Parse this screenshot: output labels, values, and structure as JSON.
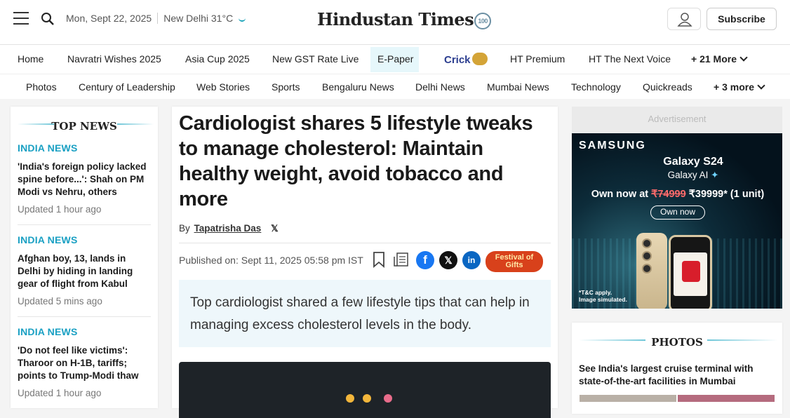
{
  "header": {
    "date": "Mon, Sept 22, 2025",
    "weather": "New Delhi 31°C",
    "logo_text": "Hindustan Times",
    "logo_badge": "100",
    "subscribe_label": "Subscribe"
  },
  "nav_primary": [
    "Home",
    "Navratri Wishes 2025",
    "Asia Cup 2025",
    "New GST Rate Live",
    "E-Paper",
    "Crick",
    "HT Premium",
    "HT The Next Voice",
    "+ 21 More"
  ],
  "nav_secondary": [
    "Photos",
    "Century of Leadership",
    "Web Stories",
    "Sports",
    "Bengaluru News",
    "Delhi News",
    "Mumbai News",
    "Technology",
    "Quickreads",
    "+ 3 more"
  ],
  "top_news": {
    "heading": "TOP NEWS",
    "items": [
      {
        "category": "INDIA NEWS",
        "title": "'India's foreign policy lacked spine before...': Shah on PM Modi vs Nehru, others",
        "updated": "Updated 1 hour ago"
      },
      {
        "category": "INDIA NEWS",
        "title": "Afghan boy, 13, lands in Delhi by hiding in landing gear of flight from Kabul",
        "updated": "Updated 5 mins ago"
      },
      {
        "category": "INDIA NEWS",
        "title": "'Do not feel like victims': Tharoor on H-1B, tariffs; points to Trump-Modi thaw",
        "updated": "Updated 1 hour ago"
      }
    ]
  },
  "article": {
    "headline": "Cardiologist shares 5 lifestyle tweaks to manage cholesterol: Maintain healthy weight, avoid tobacco and more",
    "by": "By",
    "author": "Tapatrisha Das",
    "published": "Published on: Sept 11, 2025 05:58 pm IST",
    "festival_label": "Festival of Gifts",
    "summary": "Top cardiologist shared a few lifestyle tips that can help in managing excess cholesterol levels in the body."
  },
  "ad": {
    "label": "Advertisement",
    "brand": "SAMSUNG",
    "model": "Galaxy S24",
    "ai": "Galaxy AI",
    "price_prefix": "Own now at",
    "old_price": "₹74999",
    "new_price": "₹39999* (1 unit)",
    "cta": "Own now",
    "terms": "*T&C apply. Image simulated."
  },
  "photos": {
    "heading": "PHOTOS",
    "title": "See India's largest cruise terminal with state-of-the-art facilities in Mumbai"
  },
  "colors": {
    "accent": "#1aa0c3",
    "festival": "#d8411b",
    "facebook": "#1877f2",
    "linkedin": "#0a66c2"
  }
}
